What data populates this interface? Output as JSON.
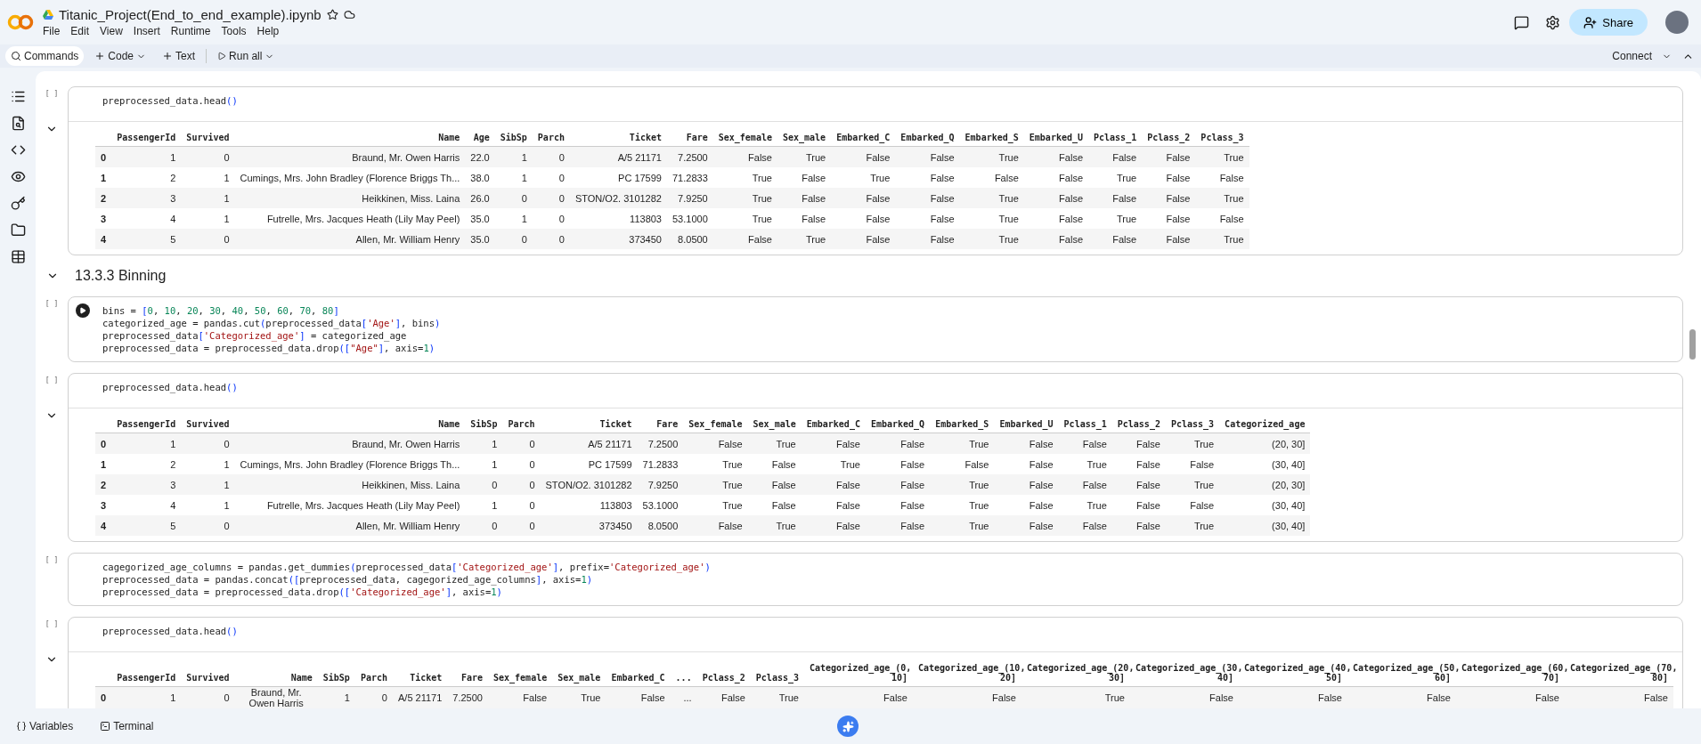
{
  "app": {
    "title": "Titanic_Project(End_to_end_example).ipynb",
    "menus": [
      "File",
      "Edit",
      "View",
      "Insert",
      "Runtime",
      "Tools",
      "Help"
    ],
    "share": "Share"
  },
  "toolbar": {
    "commands": "Commands",
    "code": "Code",
    "text": "Text",
    "run_all": "Run all",
    "connect": "Connect"
  },
  "cells": [
    {
      "kind": "code",
      "count": "[ ]",
      "run_button": false,
      "lines": [
        [
          {
            "kind": "plain",
            "text": "preprocessed_data.head"
          },
          {
            "kind": "bracket",
            "text": "()"
          }
        ]
      ],
      "output": {
        "columns": [
          "PassengerId",
          "Survived",
          "Name",
          "Age",
          "SibSp",
          "Parch",
          "Ticket",
          "Fare",
          "Sex_female",
          "Sex_male",
          "Embarked_C",
          "Embarked_Q",
          "Embarked_S",
          "Embarked_U",
          "Pclass_1",
          "Pclass_2",
          "Pclass_3"
        ],
        "rows": [
          {
            "index": "0",
            "cells": [
              "1",
              "0",
              "Braund, Mr. Owen Harris",
              "22.0",
              "1",
              "0",
              "A/5 21171",
              "7.2500",
              "False",
              "True",
              "False",
              "False",
              "True",
              "False",
              "False",
              "False",
              "True"
            ]
          },
          {
            "index": "1",
            "cells": [
              "2",
              "1",
              "Cumings, Mrs. John Bradley (Florence Briggs Th...",
              "38.0",
              "1",
              "0",
              "PC 17599",
              "71.2833",
              "True",
              "False",
              "True",
              "False",
              "False",
              "False",
              "True",
              "False",
              "False"
            ]
          },
          {
            "index": "2",
            "cells": [
              "3",
              "1",
              "Heikkinen, Miss. Laina",
              "26.0",
              "0",
              "0",
              "STON/O2. 3101282",
              "7.9250",
              "True",
              "False",
              "False",
              "False",
              "True",
              "False",
              "False",
              "False",
              "True"
            ]
          },
          {
            "index": "3",
            "cells": [
              "4",
              "1",
              "Futrelle, Mrs. Jacques Heath (Lily May Peel)",
              "35.0",
              "1",
              "0",
              "113803",
              "53.1000",
              "True",
              "False",
              "False",
              "False",
              "True",
              "False",
              "True",
              "False",
              "False"
            ]
          },
          {
            "index": "4",
            "cells": [
              "5",
              "0",
              "Allen, Mr. William Henry",
              "35.0",
              "0",
              "0",
              "373450",
              "8.0500",
              "False",
              "True",
              "False",
              "False",
              "True",
              "False",
              "False",
              "False",
              "True"
            ]
          }
        ]
      }
    },
    {
      "kind": "heading",
      "text": "13.3.3 Binning"
    },
    {
      "kind": "code",
      "count": "[ ]",
      "run_button": true,
      "lines": [
        [
          {
            "kind": "plain",
            "text": "bins = "
          },
          {
            "kind": "bracket",
            "text": "["
          },
          {
            "kind": "num",
            "text": "0"
          },
          {
            "kind": "plain",
            "text": ", "
          },
          {
            "kind": "num",
            "text": "10"
          },
          {
            "kind": "plain",
            "text": ", "
          },
          {
            "kind": "num",
            "text": "20"
          },
          {
            "kind": "plain",
            "text": ", "
          },
          {
            "kind": "num",
            "text": "30"
          },
          {
            "kind": "plain",
            "text": ", "
          },
          {
            "kind": "num",
            "text": "40"
          },
          {
            "kind": "plain",
            "text": ", "
          },
          {
            "kind": "num",
            "text": "50"
          },
          {
            "kind": "plain",
            "text": ", "
          },
          {
            "kind": "num",
            "text": "60"
          },
          {
            "kind": "plain",
            "text": ", "
          },
          {
            "kind": "num",
            "text": "70"
          },
          {
            "kind": "plain",
            "text": ", "
          },
          {
            "kind": "num",
            "text": "80"
          },
          {
            "kind": "bracket",
            "text": "]"
          }
        ],
        [
          {
            "kind": "plain",
            "text": "categorized_age = pandas.cut"
          },
          {
            "kind": "bracket",
            "text": "("
          },
          {
            "kind": "plain",
            "text": "preprocessed_data"
          },
          {
            "kind": "bracket",
            "text": "["
          },
          {
            "kind": "str",
            "text": "'Age'"
          },
          {
            "kind": "bracket",
            "text": "]"
          },
          {
            "kind": "plain",
            "text": ", bins"
          },
          {
            "kind": "bracket",
            "text": ")"
          }
        ],
        [
          {
            "kind": "plain",
            "text": "preprocessed_data"
          },
          {
            "kind": "bracket",
            "text": "["
          },
          {
            "kind": "str",
            "text": "'Categorized_age'"
          },
          {
            "kind": "bracket",
            "text": "]"
          },
          {
            "kind": "plain",
            "text": " = categorized_age"
          }
        ],
        [
          {
            "kind": "plain",
            "text": "preprocessed_data = preprocessed_data.drop"
          },
          {
            "kind": "bracket",
            "text": "(["
          },
          {
            "kind": "str",
            "text": "\"Age\""
          },
          {
            "kind": "bracket",
            "text": "]"
          },
          {
            "kind": "plain",
            "text": ", axis="
          },
          {
            "kind": "num",
            "text": "1"
          },
          {
            "kind": "bracket",
            "text": ")"
          }
        ]
      ]
    },
    {
      "kind": "code",
      "count": "[ ]",
      "run_button": false,
      "lines": [
        [
          {
            "kind": "plain",
            "text": "preprocessed_data.head"
          },
          {
            "kind": "bracket",
            "text": "()"
          }
        ]
      ],
      "output": {
        "columns": [
          "PassengerId",
          "Survived",
          "Name",
          "SibSp",
          "Parch",
          "Ticket",
          "Fare",
          "Sex_female",
          "Sex_male",
          "Embarked_C",
          "Embarked_Q",
          "Embarked_S",
          "Embarked_U",
          "Pclass_1",
          "Pclass_2",
          "Pclass_3",
          "Categorized_age"
        ],
        "rows": [
          {
            "index": "0",
            "cells": [
              "1",
              "0",
              "Braund, Mr. Owen Harris",
              "1",
              "0",
              "A/5 21171",
              "7.2500",
              "False",
              "True",
              "False",
              "False",
              "True",
              "False",
              "False",
              "False",
              "True",
              "(20, 30]"
            ]
          },
          {
            "index": "1",
            "cells": [
              "2",
              "1",
              "Cumings, Mrs. John Bradley (Florence Briggs Th...",
              "1",
              "0",
              "PC 17599",
              "71.2833",
              "True",
              "False",
              "True",
              "False",
              "False",
              "False",
              "True",
              "False",
              "False",
              "(30, 40]"
            ]
          },
          {
            "index": "2",
            "cells": [
              "3",
              "1",
              "Heikkinen, Miss. Laina",
              "0",
              "0",
              "STON/O2. 3101282",
              "7.9250",
              "True",
              "False",
              "False",
              "False",
              "True",
              "False",
              "False",
              "False",
              "True",
              "(20, 30]"
            ]
          },
          {
            "index": "3",
            "cells": [
              "4",
              "1",
              "Futrelle, Mrs. Jacques Heath (Lily May Peel)",
              "1",
              "0",
              "113803",
              "53.1000",
              "True",
              "False",
              "False",
              "False",
              "True",
              "False",
              "True",
              "False",
              "False",
              "(30, 40]"
            ]
          },
          {
            "index": "4",
            "cells": [
              "5",
              "0",
              "Allen, Mr. William Henry",
              "0",
              "0",
              "373450",
              "8.0500",
              "False",
              "True",
              "False",
              "False",
              "True",
              "False",
              "False",
              "False",
              "True",
              "(30, 40]"
            ]
          }
        ]
      }
    },
    {
      "kind": "code",
      "count": "[ ]",
      "run_button": false,
      "lines": [
        [
          {
            "kind": "plain",
            "text": "cagegorized_age_columns = pandas.get_dummies"
          },
          {
            "kind": "bracket",
            "text": "("
          },
          {
            "kind": "plain",
            "text": "preprocessed_data"
          },
          {
            "kind": "bracket",
            "text": "["
          },
          {
            "kind": "str",
            "text": "'Categorized_age'"
          },
          {
            "kind": "bracket",
            "text": "]"
          },
          {
            "kind": "plain",
            "text": ", prefix="
          },
          {
            "kind": "str",
            "text": "'Categorized_age'"
          },
          {
            "kind": "bracket",
            "text": ")"
          }
        ],
        [
          {
            "kind": "plain",
            "text": "preprocessed_data = pandas.concat"
          },
          {
            "kind": "bracket",
            "text": "(["
          },
          {
            "kind": "plain",
            "text": "preprocessed_data, cagegorized_age_columns"
          },
          {
            "kind": "bracket",
            "text": "]"
          },
          {
            "kind": "plain",
            "text": ", axis="
          },
          {
            "kind": "num",
            "text": "1"
          },
          {
            "kind": "bracket",
            "text": ")"
          }
        ],
        [
          {
            "kind": "plain",
            "text": "preprocessed_data = preprocessed_data.drop"
          },
          {
            "kind": "bracket",
            "text": "(["
          },
          {
            "kind": "str",
            "text": "'Categorized_age'"
          },
          {
            "kind": "bracket",
            "text": "]"
          },
          {
            "kind": "plain",
            "text": ", axis="
          },
          {
            "kind": "num",
            "text": "1"
          },
          {
            "kind": "bracket",
            "text": ")"
          }
        ]
      ]
    },
    {
      "kind": "code",
      "count": "[ ]",
      "run_button": false,
      "lines": [
        [
          {
            "kind": "plain",
            "text": "preprocessed_data.head"
          },
          {
            "kind": "bracket",
            "text": "()"
          }
        ]
      ],
      "output": {
        "columns": [
          "PassengerId",
          "Survived",
          "Name",
          "SibSp",
          "Parch",
          "Ticket",
          "Fare",
          "Sex_female",
          "Sex_male",
          "Embarked_C",
          "...",
          "Pclass_2",
          "Pclass_3",
          "Categorized_age_(0, 10]",
          "Categorized_age_(10, 20]",
          "Categorized_age_(20, 30]",
          "Categorized_age_(30, 40]",
          "Categorized_age_(40, 50]",
          "Categorized_age_(50, 60]",
          "Categorized_age_(60, 70]",
          "Categorized_age_(70, 80]"
        ],
        "rows": [
          {
            "index": "0",
            "cells": [
              "1",
              "0",
              "Braund, Mr. Owen Harris",
              "1",
              "0",
              "A/5 21171",
              "7.2500",
              "False",
              "True",
              "False",
              "...",
              "False",
              "True",
              "False",
              "False",
              "True",
              "False",
              "False",
              "False",
              "False",
              "False"
            ]
          }
        ]
      }
    }
  ],
  "bottom": {
    "variables": "Variables",
    "terminal": "Terminal"
  }
}
